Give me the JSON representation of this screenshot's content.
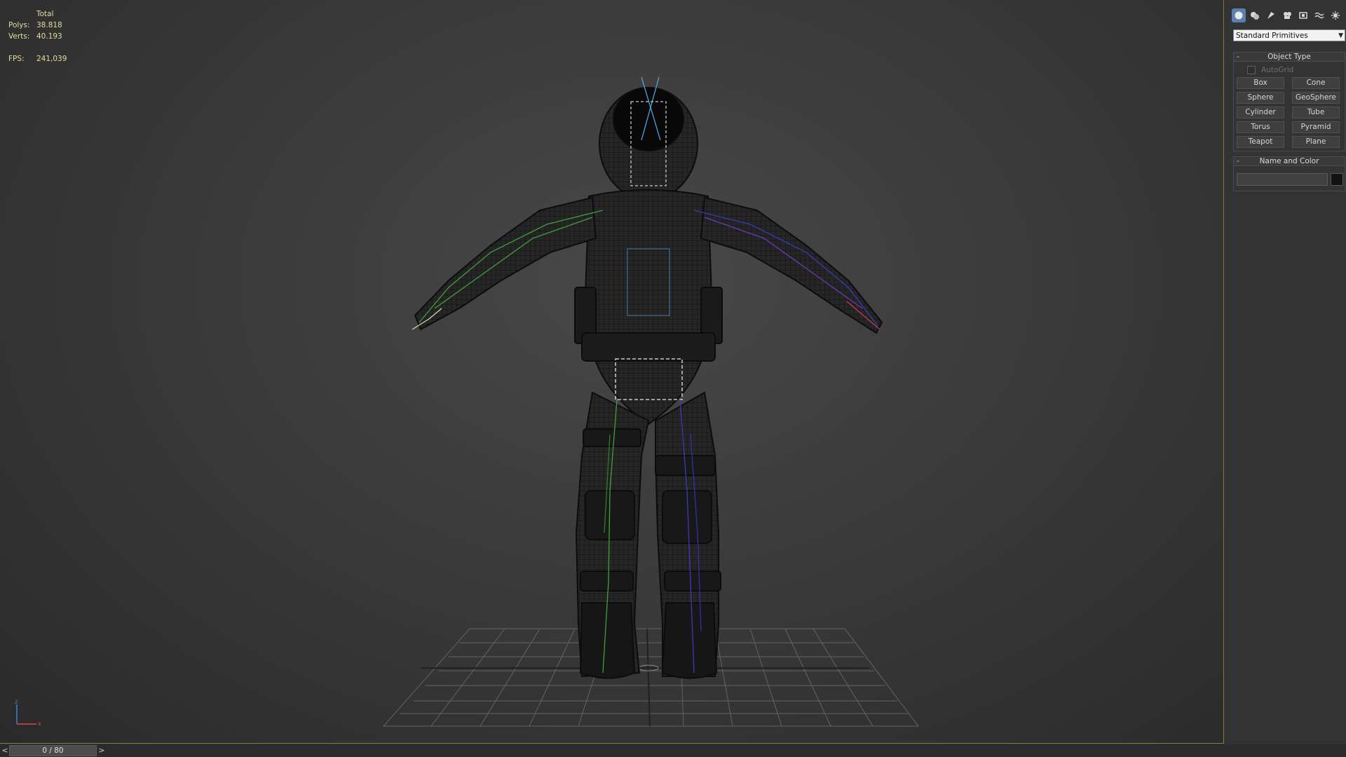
{
  "viewport": {
    "stats": {
      "header": "Total",
      "polys_label": "Polys:",
      "polys_value": "38.818",
      "verts_label": "Verts:",
      "verts_value": "40.193",
      "fps_label": "FPS:",
      "fps_value": "241,039"
    },
    "axis": {
      "z_label": "z",
      "x_label": "x"
    },
    "colors": {
      "stats_text": "#e6dca0",
      "border_active": "#8a7a3c",
      "bone_left": "#3fa03f",
      "bone_right": "#3a3ab8"
    }
  },
  "command_panel": {
    "tabs": [
      {
        "icon": "geometry-icon",
        "active": true
      },
      {
        "icon": "shapes-icon",
        "active": false
      },
      {
        "icon": "lights-icon",
        "active": false
      },
      {
        "icon": "cameras-icon",
        "active": false
      },
      {
        "icon": "helpers-icon",
        "active": false
      },
      {
        "icon": "spacewarps-icon",
        "active": false
      },
      {
        "icon": "systems-icon",
        "active": false
      }
    ],
    "category_dropdown": "Standard Primitives",
    "object_type": {
      "title": "Object Type",
      "collapse_symbol": "-",
      "autogrid_label": "AutoGrid",
      "buttons": [
        "Box",
        "Cone",
        "Sphere",
        "GeoSphere",
        "Cylinder",
        "Tube",
        "Torus",
        "Pyramid",
        "Teapot",
        "Plane"
      ]
    },
    "name_and_color": {
      "title": "Name and Color",
      "collapse_symbol": "-",
      "name_value": "",
      "swatch_color": "#111111"
    }
  },
  "timeline": {
    "prev": "<",
    "next": ">",
    "frame_display": "0 / 80"
  }
}
